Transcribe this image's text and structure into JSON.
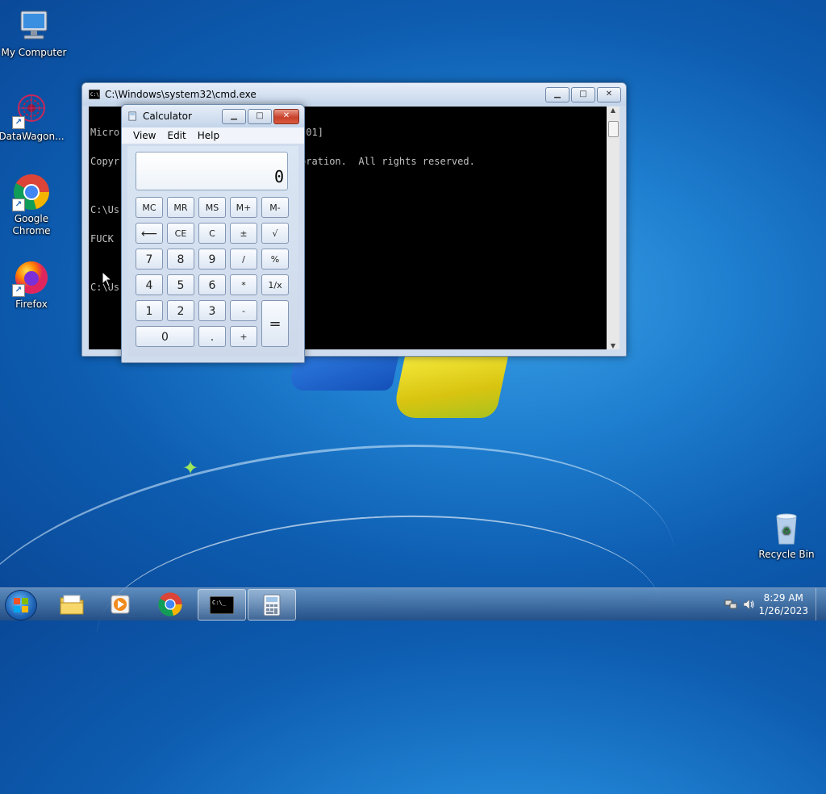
{
  "desktop": {
    "icons": [
      {
        "label": "My Computer"
      },
      {
        "label": "DataWagon..."
      },
      {
        "label": "Google Chrome"
      },
      {
        "label": "Firefox"
      },
      {
        "label": "Recycle Bin"
      }
    ]
  },
  "cmd": {
    "title": "C:\\Windows\\system32\\cmd.exe",
    "lines": [
      "Micro                                01]",
      "Copyr                               oration.  All rights reserved.",
      "",
      "C:\\Us",
      "FUCK",
      "",
      "C:\\Us"
    ]
  },
  "calculator": {
    "title": "Calculator",
    "menu": [
      "View",
      "Edit",
      "Help"
    ],
    "display": "0",
    "buttons": {
      "mc": "MC",
      "mr": "MR",
      "ms": "MS",
      "mplus": "M+",
      "mminus": "M-",
      "back": "⟵",
      "ce": "CE",
      "c": "C",
      "plusminus": "±",
      "sqrt": "√",
      "n7": "7",
      "n8": "8",
      "n9": "9",
      "div": "/",
      "pct": "%",
      "n4": "4",
      "n5": "5",
      "n6": "6",
      "mul": "*",
      "recip": "1/x",
      "n1": "1",
      "n2": "2",
      "n3": "3",
      "sub": "-",
      "eq": "=",
      "n0": "0",
      "dot": ".",
      "add": "+"
    }
  },
  "window_controls": {
    "minimize": "▁",
    "maximize": "□",
    "close": "✕"
  },
  "taskbar": {
    "time": "8:29 AM",
    "date": "1/26/2023"
  }
}
